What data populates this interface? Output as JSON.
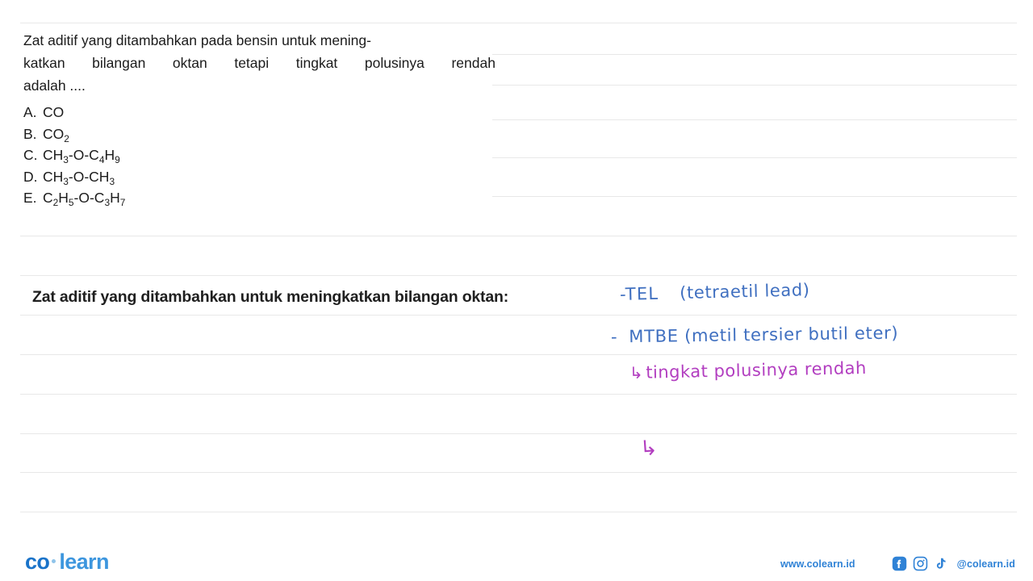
{
  "document": {
    "background_color": "#ffffff",
    "rule_color": "#e8e8e8"
  },
  "question_top": {
    "text_lines": [
      "Zat aditif yang ditambahkan pada bensin untuk mening-",
      "katkan bilangan oktan tetapi tingkat polusinya rendah",
      "adalah ...."
    ],
    "line2_words": [
      "katkan",
      "bilangan",
      "oktan",
      "tetapi",
      "tingkat",
      "polusinya",
      "rendah"
    ],
    "options": [
      {
        "label": "A.",
        "formula_plain": "CO",
        "parts": [
          {
            "t": "CO"
          }
        ]
      },
      {
        "label": "B.",
        "formula_plain": "CO2",
        "parts": [
          {
            "t": "CO"
          },
          {
            "t": "2",
            "sub": true
          }
        ]
      },
      {
        "label": "C.",
        "formula_plain": "CH3-O-C4H9",
        "parts": [
          {
            "t": "CH"
          },
          {
            "t": "3",
            "sub": true
          },
          {
            "t": "-O-C"
          },
          {
            "t": "4",
            "sub": true
          },
          {
            "t": "H"
          },
          {
            "t": "9",
            "sub": true
          }
        ]
      },
      {
        "label": "D.",
        "formula_plain": "CH3-O-CH3",
        "parts": [
          {
            "t": "CH"
          },
          {
            "t": "3",
            "sub": true
          },
          {
            "t": "-O-CH"
          },
          {
            "t": "3",
            "sub": true
          }
        ]
      },
      {
        "label": "E.",
        "formula_plain": "C2H5-O-C3H7",
        "parts": [
          {
            "t": "C"
          },
          {
            "t": "2",
            "sub": true
          },
          {
            "t": "H"
          },
          {
            "t": "5",
            "sub": true
          },
          {
            "t": "-O-C"
          },
          {
            "t": "3",
            "sub": true
          },
          {
            "t": "H"
          },
          {
            "t": "7",
            "sub": true
          }
        ]
      }
    ]
  },
  "question_bottom": {
    "text": "Zat aditif yang ditambahkan untuk meningkatkan bilangan oktan:"
  },
  "annotations": {
    "blue_color": "#3f6fc0",
    "purple_color": "#b23ec0",
    "line1_name": "TEL",
    "line1_prefix": "-",
    "line1_text": "-TEL",
    "line1_expansion": "(tetraetil lead)",
    "line2_prefix": "-",
    "line2_text": "MTBE",
    "line2_expansion": "(metil tersier butil eter)",
    "line3_arrow": "↳",
    "line3_text": "tingkat polusinya rendah",
    "mark_text": "↳"
  },
  "footer": {
    "logo_co": "co",
    "logo_learn": "learn",
    "url": "www.colearn.id",
    "handle": "@colearn.id",
    "brand_color": "#2f82d6",
    "social": [
      {
        "name": "facebook-icon"
      },
      {
        "name": "instagram-icon"
      },
      {
        "name": "tiktok-icon"
      }
    ]
  }
}
